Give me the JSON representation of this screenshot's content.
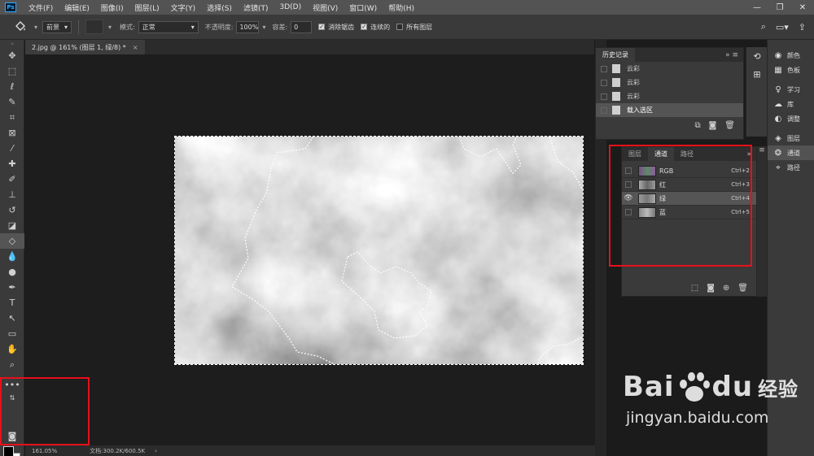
{
  "app": {
    "logo": "Ps"
  },
  "menu": [
    "文件(F)",
    "编辑(E)",
    "图像(I)",
    "图层(L)",
    "文字(Y)",
    "选择(S)",
    "滤镜(T)",
    "3D(D)",
    "视图(V)",
    "窗口(W)",
    "帮助(H)"
  ],
  "window_controls": {
    "minimize": "—",
    "restore": "❐",
    "close": "✕"
  },
  "options": {
    "fill_source": "前景",
    "mode_label": "模式:",
    "mode_value": "正常",
    "opacity_label": "不透明度:",
    "opacity_value": "100%",
    "tolerance_label": "容差:",
    "tolerance_value": "0",
    "antialias": "消除锯齿",
    "contiguous": "连续的",
    "all_layers": "所有图层"
  },
  "document_tab": {
    "title": "2.jpg @ 161% (图层 1, 绿/8) *",
    "close": "×"
  },
  "status": {
    "zoom": "161.05%",
    "doc": "文档:300.2K/600.5K",
    "arrow": "›"
  },
  "history": {
    "title": "历史记录",
    "items": [
      {
        "label": "云彩",
        "selected": false
      },
      {
        "label": "云彩",
        "selected": false
      },
      {
        "label": "云彩",
        "selected": false
      },
      {
        "label": "载入选区",
        "selected": true
      }
    ]
  },
  "channels_panel": {
    "tabs": [
      "图层",
      "通道",
      "路径"
    ],
    "active_tab": "通道",
    "channels": [
      {
        "name": "RGB",
        "shortcut": "Ctrl+2",
        "visible": false,
        "selected": false
      },
      {
        "name": "红",
        "shortcut": "Ctrl+3",
        "visible": false,
        "selected": false
      },
      {
        "name": "绿",
        "shortcut": "Ctrl+4",
        "visible": true,
        "selected": true
      },
      {
        "name": "蓝",
        "shortcut": "Ctrl+5",
        "visible": false,
        "selected": false
      }
    ]
  },
  "right_strip": [
    {
      "icon": "palette-icon",
      "glyph": "🎨",
      "label": "颜色"
    },
    {
      "icon": "swatches-icon",
      "glyph": "▦",
      "label": "色板"
    },
    {
      "icon": "learn-icon",
      "glyph": "💡",
      "label": "学习"
    },
    {
      "icon": "libraries-icon",
      "glyph": "☁",
      "label": "库"
    },
    {
      "icon": "adjustments-icon",
      "glyph": "◐",
      "label": "调整"
    },
    {
      "icon": "layers-icon",
      "glyph": "◈",
      "label": "图层"
    },
    {
      "icon": "channels-icon",
      "glyph": "❂",
      "label": "通道"
    },
    {
      "icon": "paths-icon",
      "glyph": "⌖",
      "label": "路径"
    }
  ],
  "watermark": {
    "brand_a": "Bai",
    "brand_b": "du",
    "cn": "经验",
    "url": "jingyan.baidu.com"
  },
  "colors": {
    "highlight": "#e8101a",
    "menubar": "#535353",
    "panel": "#3a3a3a"
  }
}
